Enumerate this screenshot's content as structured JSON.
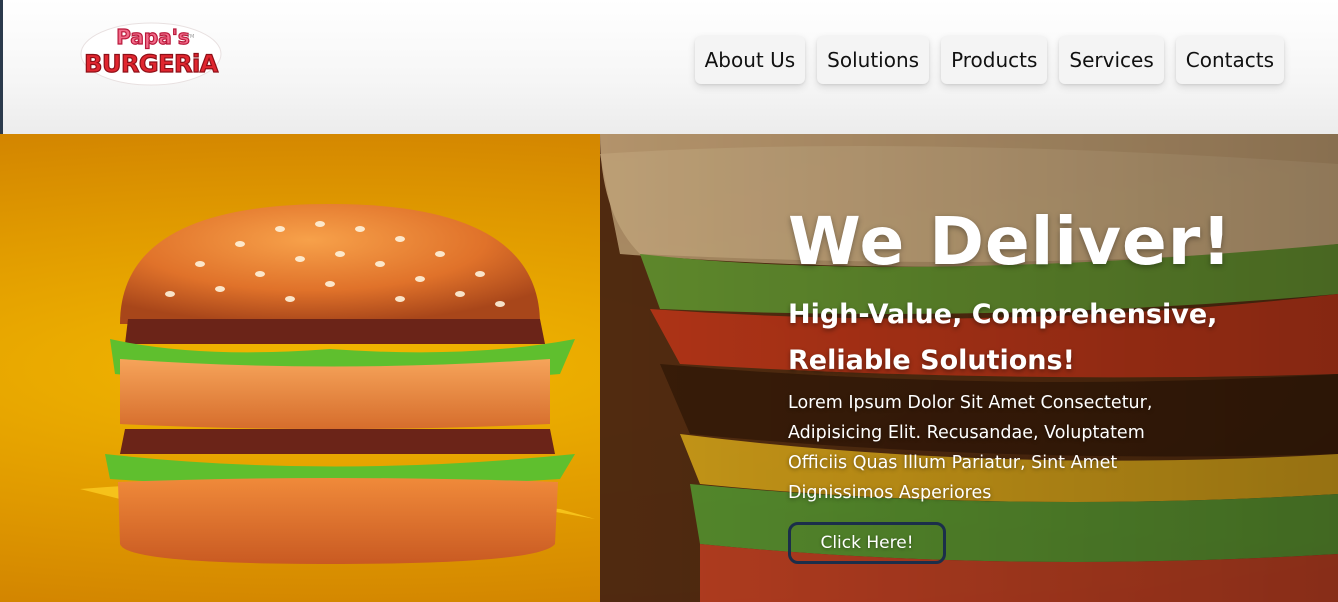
{
  "brand": {
    "logo_line1": "Papa's",
    "logo_line2": "BURGERiA",
    "logo_tm": "TM"
  },
  "nav": {
    "items": [
      {
        "label": "About Us"
      },
      {
        "label": "Solutions"
      },
      {
        "label": "Products"
      },
      {
        "label": "Services"
      },
      {
        "label": "Contacts"
      }
    ]
  },
  "hero": {
    "title": "We Deliver!",
    "subtitle": "High-Value, Comprehensive, Reliable Solutions!",
    "body": "Lorem Ipsum Dolor Sit Amet Consectetur, Adipisicing Elit. Recusandae, Voluptatem Officiis Quas Illum Pariatur, Sint Amet Dignissimos Asperiores",
    "cta_label": "Click Here!"
  },
  "colors": {
    "logo_red": "#e0262f",
    "logo_pink": "#f26b8a",
    "hero_yellow": "#f2b800",
    "cta_border": "#1b2e4a"
  }
}
